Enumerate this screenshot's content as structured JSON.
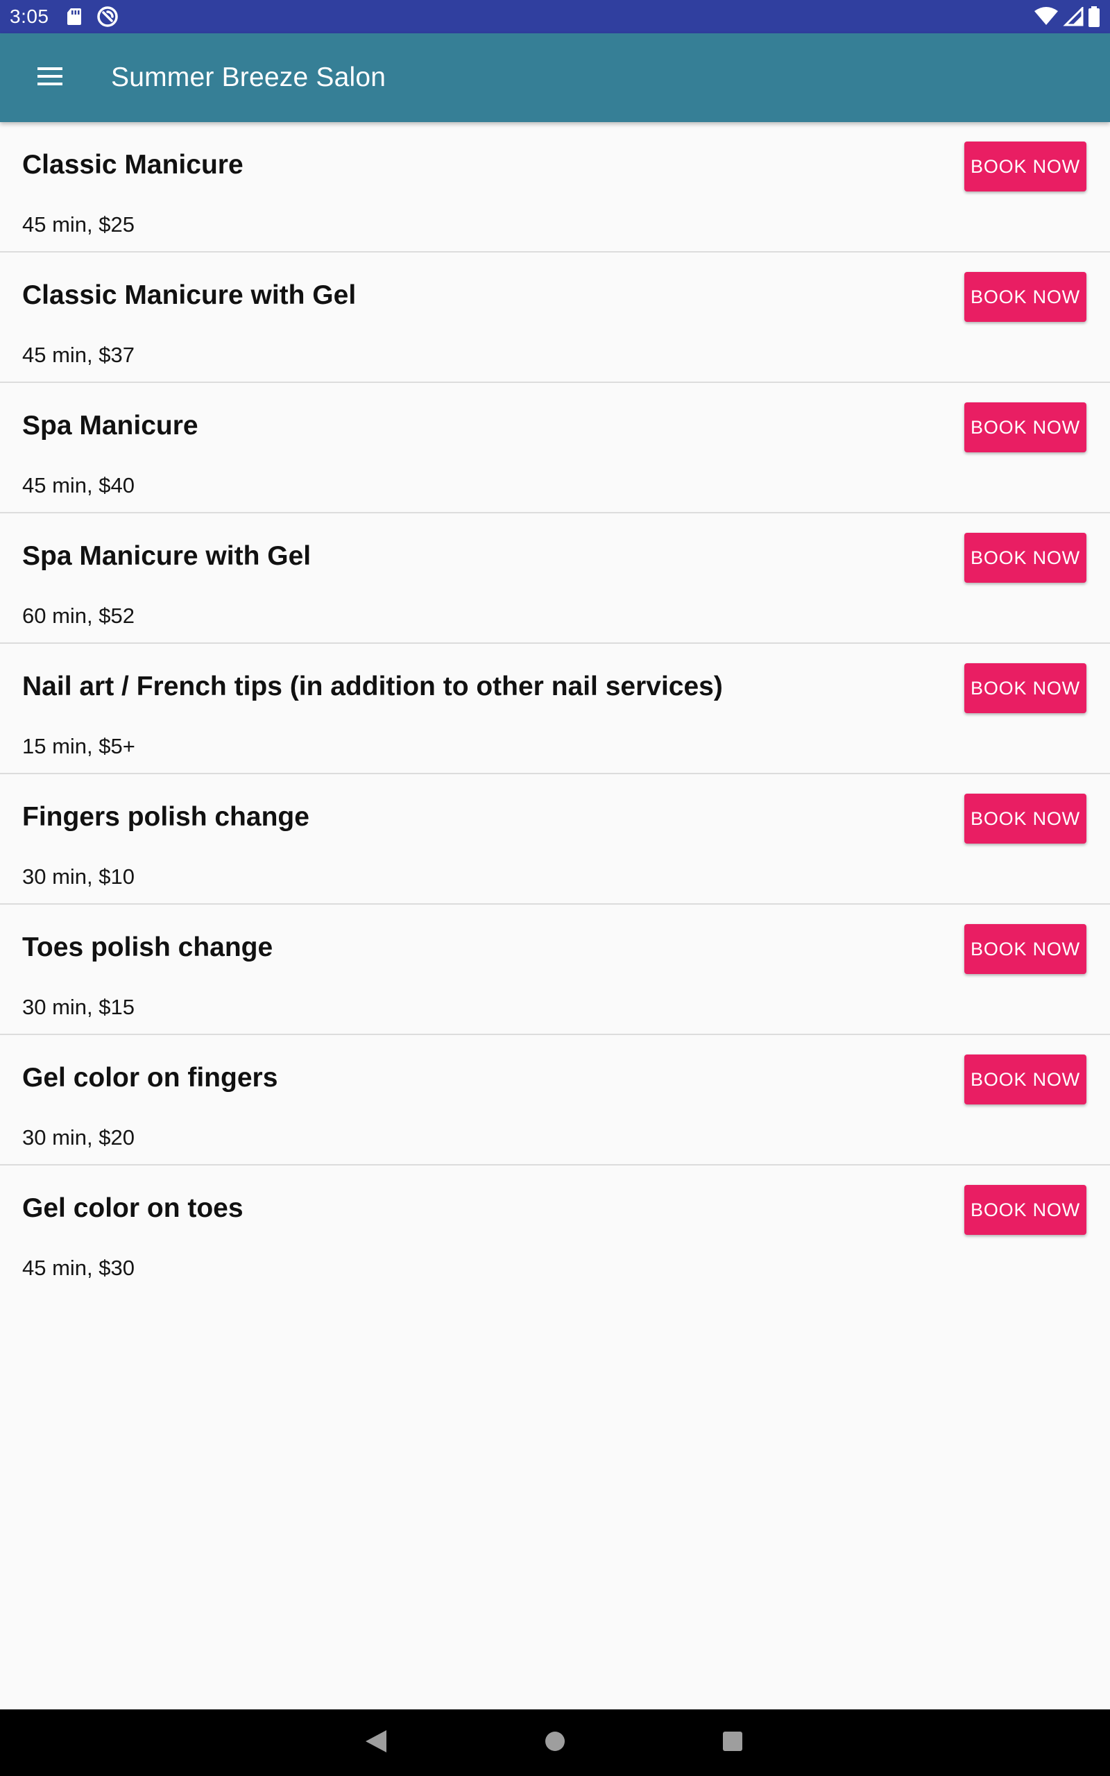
{
  "status_bar": {
    "time": "3:05",
    "icons": [
      "sd-card-icon",
      "sync-icon",
      "wifi-icon",
      "cell-signal-icon",
      "battery-icon"
    ]
  },
  "app_bar": {
    "title": "Summer Breeze Salon",
    "menu_icon": "menu-icon"
  },
  "services": [
    {
      "name": "Classic Manicure",
      "detail": "45 min, $25",
      "button": "BOOK NOW"
    },
    {
      "name": "Classic Manicure with Gel",
      "detail": "45 min, $37",
      "button": "BOOK NOW"
    },
    {
      "name": "Spa Manicure",
      "detail": "45 min, $40",
      "button": "BOOK NOW"
    },
    {
      "name": "Spa Manicure with Gel",
      "detail": "60 min, $52",
      "button": "BOOK NOW"
    },
    {
      "name": "Nail art / French tips (in addition to other nail services)",
      "detail": "15 min, $5+",
      "button": "BOOK NOW"
    },
    {
      "name": "Fingers polish change",
      "detail": "30 min, $10",
      "button": "BOOK NOW"
    },
    {
      "name": "Toes polish change",
      "detail": "30 min, $15",
      "button": "BOOK NOW"
    },
    {
      "name": "Gel color on fingers",
      "detail": "30 min, $20",
      "button": "BOOK NOW"
    },
    {
      "name": "Gel color on toes",
      "detail": "45 min, $30",
      "button": "BOOK NOW"
    }
  ],
  "nav_bar": {
    "buttons": [
      "back-icon",
      "home-icon",
      "recents-icon"
    ]
  },
  "colors": {
    "status_bar": "#303f9f",
    "app_bar": "#367f96",
    "accent": "#e91e63",
    "background": "#fafafa",
    "divider": "#dcdcdc"
  }
}
